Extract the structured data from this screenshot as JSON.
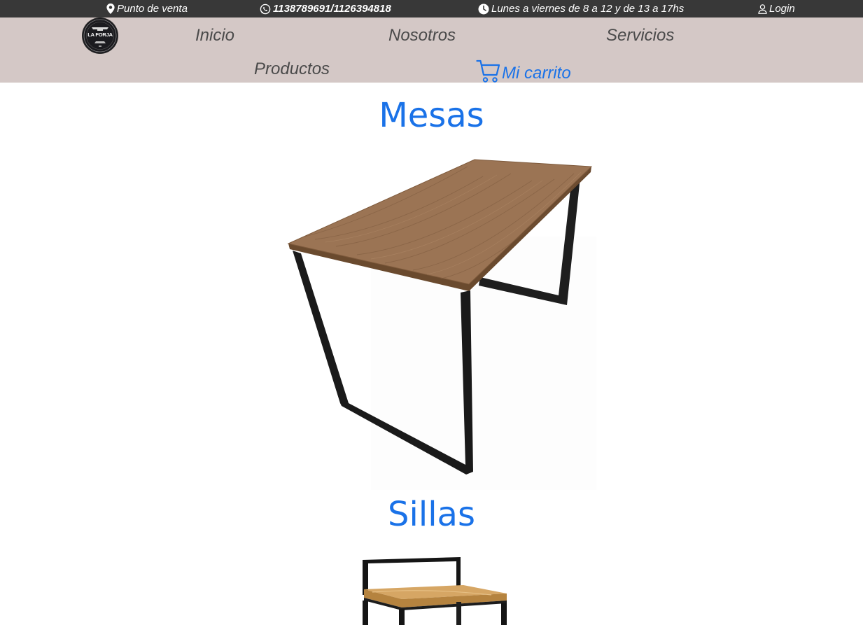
{
  "topbar": {
    "location": "Punto de venta",
    "phone": "1138789691/1126394818",
    "hours": "Lunes a viernes de 8 a 12 y de 13 a 17hs",
    "login": "Login"
  },
  "brand": {
    "logo_text": "LA FORJA"
  },
  "nav": {
    "inicio": "Inicio",
    "nosotros": "Nosotros",
    "servicios": "Servicios",
    "productos": "Productos",
    "cart": "Mi carrito"
  },
  "sections": [
    {
      "title": "Mesas"
    },
    {
      "title": "Sillas"
    }
  ],
  "colors": {
    "topbar_bg": "#383838",
    "navbar_bg": "#d4c8c6",
    "accent": "#1a72e8",
    "nav_text": "#4a4a4a"
  },
  "icons": {
    "location": "map-pin-icon",
    "phone": "whatsapp-icon",
    "hours": "clock-icon",
    "login": "user-icon",
    "cart": "shopping-cart-icon"
  }
}
